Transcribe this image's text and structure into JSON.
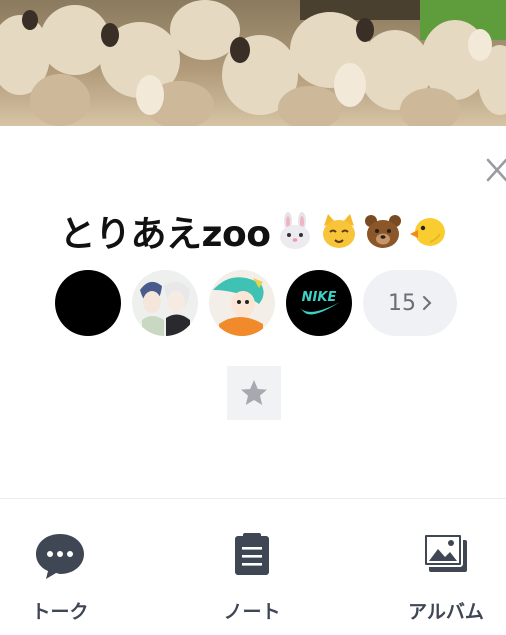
{
  "group": {
    "name": "とりあえzoo",
    "emojis": [
      "rabbit-face-icon",
      "cat-face-icon",
      "bear-face-icon",
      "baby-chick-icon"
    ]
  },
  "members": {
    "avatars": [
      "black-avatar",
      "anime-duo-avatar",
      "anime-girl-avatar",
      "nike-logo-avatar"
    ],
    "count": "15"
  },
  "actions": {
    "talk_label": "トーク",
    "note_label": "ノート",
    "album_label": "アルバム"
  },
  "colors": {
    "icon_dark": "#3f4654",
    "count_bg": "#eff1f4",
    "favorite_bg": "#f1f2f4",
    "star": "#a6a9b0"
  }
}
